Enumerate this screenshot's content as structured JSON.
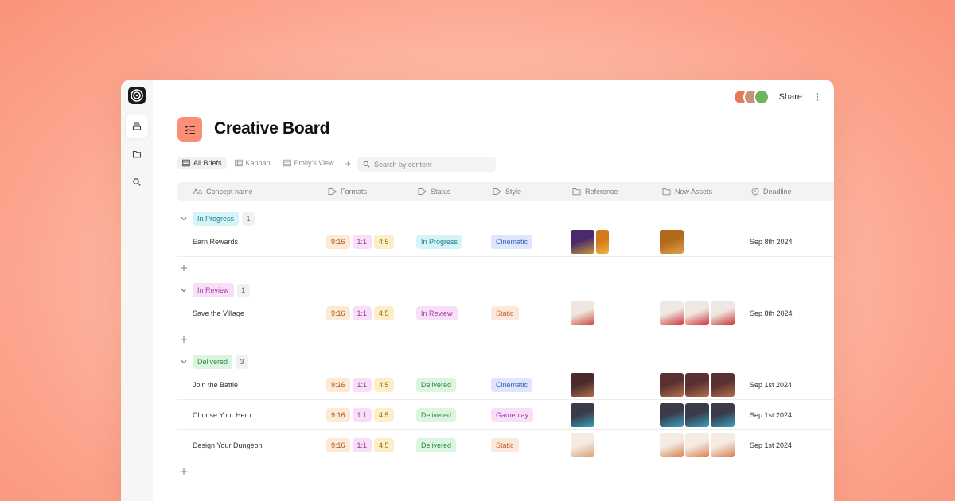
{
  "app": {
    "title": "Creative Board",
    "share_label": "Share",
    "avatars": [
      "#e87a5c",
      "#c99279",
      "#6fb35e"
    ]
  },
  "views": {
    "tabs": [
      {
        "label": "All Briefs",
        "active": true
      },
      {
        "label": "Kanban",
        "active": false
      },
      {
        "label": "Emily's View",
        "active": false
      }
    ],
    "add_label": "+"
  },
  "search": {
    "placeholder": "Search by content",
    "value": ""
  },
  "columns": [
    {
      "label": "Concept name",
      "icon": "text-type-icon",
      "prefix": "Aa"
    },
    {
      "label": "Formats",
      "icon": "tag-icon"
    },
    {
      "label": "Status",
      "icon": "tag-icon"
    },
    {
      "label": "Style",
      "icon": "tag-icon"
    },
    {
      "label": "Reference",
      "icon": "folder-icon"
    },
    {
      "label": "New Assets",
      "icon": "folder-icon"
    },
    {
      "label": "Deadline",
      "icon": "clock-icon"
    }
  ],
  "formats": [
    "9:16",
    "1:1",
    "4:5"
  ],
  "colors": {
    "accent": "#fa8e77",
    "in_progress_bg": "#d5f4f7",
    "in_progress_fg": "#1b7f8a",
    "in_review_bg": "#f7e0f7",
    "in_review_fg": "#a43aa6",
    "delivered_bg": "#dcf5e0",
    "delivered_fg": "#2f8a45",
    "cinematic_bg": "#dde6fb",
    "cinematic_fg": "#3a5fc2",
    "static_bg": "#fde9dc",
    "static_fg": "#c0622e",
    "gameplay_bg": "#f7e0f7",
    "gameplay_fg": "#a43aa6"
  },
  "groups": [
    {
      "label": "In Progress",
      "count": "1",
      "rows": [
        {
          "concept": "Earn Rewards",
          "status": "In Progress",
          "style": "Cinematic",
          "deadline": "Sep 8th 2024"
        }
      ]
    },
    {
      "label": "In Review",
      "count": "1",
      "rows": [
        {
          "concept": "Save the Village",
          "status": "In Review",
          "style": "Static",
          "deadline": "Sep 8th 2024"
        }
      ]
    },
    {
      "label": "Delivered",
      "count": "3",
      "rows": [
        {
          "concept": "Join the Battle",
          "status": "Delivered",
          "style": "Cinematic",
          "deadline": "Sep 1st 2024"
        },
        {
          "concept": "Choose Your Hero",
          "status": "Delivered",
          "style": "Gameplay",
          "deadline": "Sep 1st 2024"
        },
        {
          "concept": "Design Your Dungeon",
          "status": "Delivered",
          "style": "Static",
          "deadline": "Sep 1st 2024"
        }
      ]
    }
  ]
}
